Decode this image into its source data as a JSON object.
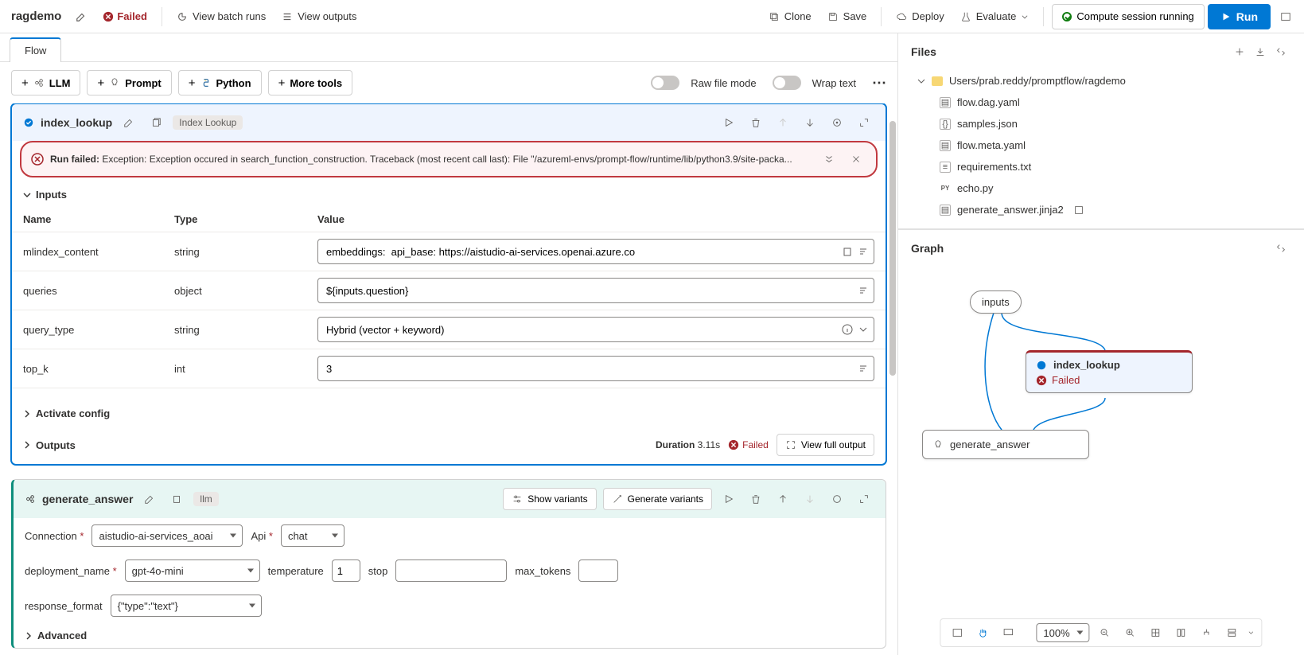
{
  "toolbar": {
    "project_name": "ragdemo",
    "failed_label": "Failed",
    "batch_runs": "View batch runs",
    "view_outputs": "View outputs",
    "clone": "Clone",
    "save": "Save",
    "deploy": "Deploy",
    "evaluate": "Evaluate",
    "compute": "Compute session running",
    "run": "Run"
  },
  "tabs": {
    "flow": "Flow"
  },
  "tools": {
    "llm": "LLM",
    "prompt": "Prompt",
    "python": "Python",
    "more": "More tools",
    "raw_file": "Raw file mode",
    "wrap_text": "Wrap text"
  },
  "node1": {
    "title": "index_lookup",
    "tag": "Index Lookup",
    "error_prefix": "Run failed:",
    "error_msg": "Exception: Exception occured in search_function_construction. Traceback (most recent call last): File \"/azureml-envs/prompt-flow/runtime/lib/python3.9/site-packa...",
    "inputs_label": "Inputs",
    "col_name": "Name",
    "col_type": "Type",
    "col_value": "Value",
    "rows": [
      {
        "name": "mlindex_content",
        "type": "string",
        "value": "embeddings:  api_base: https://aistudio-ai-services.openai.azure.co"
      },
      {
        "name": "queries",
        "type": "object",
        "value": "${inputs.question}"
      },
      {
        "name": "query_type",
        "type": "string",
        "value": "Hybrid (vector + keyword)"
      },
      {
        "name": "top_k",
        "type": "int",
        "value": "3"
      }
    ],
    "activate": "Activate config",
    "outputs": "Outputs",
    "duration_label": "Duration",
    "duration_val": "3.11s",
    "failed": "Failed",
    "view_full": "View full output"
  },
  "node2": {
    "title": "generate_answer",
    "tag": "llm",
    "show_variants": "Show variants",
    "gen_variants": "Generate variants",
    "connection_label": "Connection",
    "connection_val": "aistudio-ai-services_aoai",
    "api_label": "Api",
    "api_val": "chat",
    "deployment_label": "deployment_name",
    "deployment_val": "gpt-4o-mini",
    "temperature_label": "temperature",
    "temperature_val": "1",
    "stop_label": "stop",
    "max_tokens_label": "max_tokens",
    "response_format_label": "response_format",
    "response_format_val": "{\"type\":\"text\"}",
    "advanced": "Advanced"
  },
  "files": {
    "title": "Files",
    "root": "Users/prab.reddy/promptflow/ragdemo",
    "items": [
      {
        "name": "flow.dag.yaml",
        "icon": "file"
      },
      {
        "name": "samples.json",
        "icon": "braces"
      },
      {
        "name": "flow.meta.yaml",
        "icon": "file"
      },
      {
        "name": "requirements.txt",
        "icon": "doc"
      },
      {
        "name": "echo.py",
        "icon": "py"
      },
      {
        "name": "generate_answer.jinja2",
        "icon": "file"
      }
    ]
  },
  "graph": {
    "title": "Graph",
    "inputs": "inputs",
    "idx": "index_lookup",
    "idx_status": "Failed",
    "ans": "generate_answer",
    "zoom": "100%"
  }
}
